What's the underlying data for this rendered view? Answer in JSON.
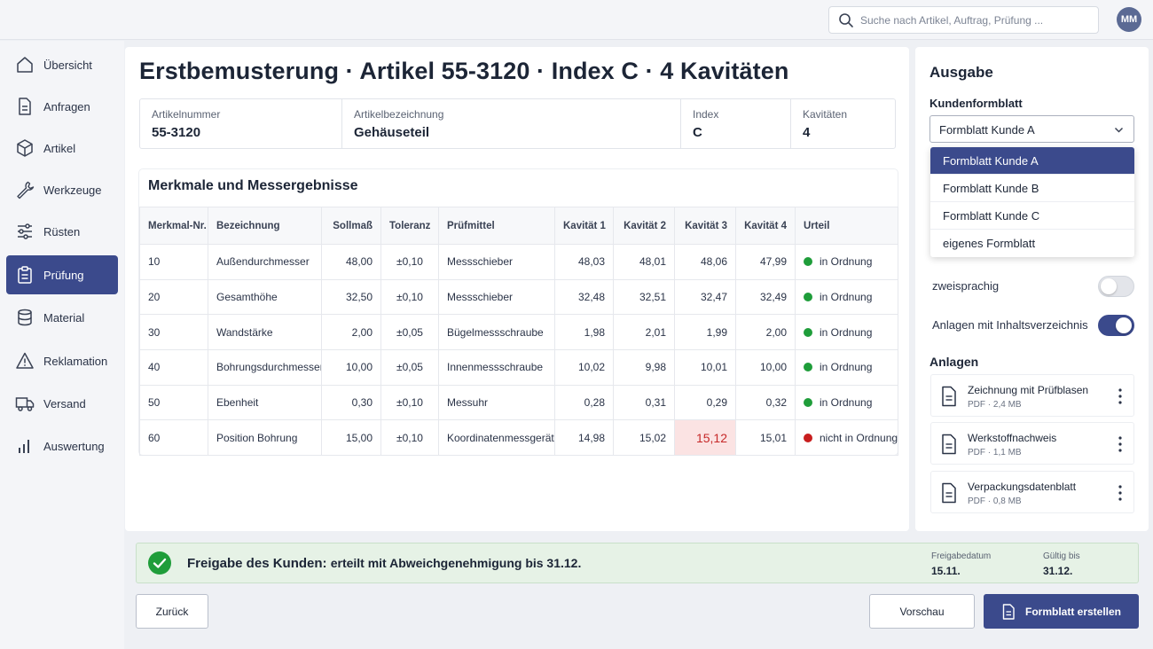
{
  "search": {
    "placeholder": "Suche nach Artikel, Auftrag, Prüfung ..."
  },
  "user": {
    "initials": "MM"
  },
  "sidebar": {
    "items": [
      {
        "label": "Übersicht",
        "icon": "home-icon"
      },
      {
        "label": "Anfragen",
        "icon": "document-icon"
      },
      {
        "label": "Artikel",
        "icon": "box-icon"
      },
      {
        "label": "Werkzeuge",
        "icon": "wrench-icon"
      },
      {
        "label": "Rüsten",
        "icon": "sliders-icon"
      },
      {
        "label": "Prüfung",
        "icon": "clipboard-icon",
        "active": true
      },
      {
        "label": "Material",
        "icon": "database-icon"
      },
      {
        "label": "Reklamation",
        "icon": "warning-icon"
      },
      {
        "label": "Versand",
        "icon": "truck-icon"
      },
      {
        "label": "Auswertung",
        "icon": "bar-chart-icon"
      }
    ]
  },
  "main": {
    "title": "Erstbemusterung · Artikel 55-3120 · Index C · 4 Kavitäten",
    "info": [
      {
        "label": "Artikelnummer",
        "value": "55-3120"
      },
      {
        "label": "Artikelbezeichnung",
        "value": "Gehäuseteil"
      },
      {
        "label": "Index",
        "value": "C"
      },
      {
        "label": "Kavitäten",
        "value": "4"
      }
    ],
    "table": {
      "title": "Merkmale und Messergebnisse",
      "headers": [
        "Merkmal-Nr.",
        "Bezeichnung",
        "Sollmaß",
        "Toleranz",
        "Prüfmittel",
        "Kavität 1",
        "Kavität 2",
        "Kavität 3",
        "Kavität 4",
        "Urteil"
      ],
      "rows": [
        {
          "nr": "10",
          "name": "Außendurchmesser",
          "soll": "48,00",
          "tol": "±0,10",
          "mittel": "Messschieber",
          "k1": "48,03",
          "k2": "48,01",
          "k3": "48,06",
          "k4": "47,99",
          "urteil": "in Ordnung",
          "ok": true
        },
        {
          "nr": "20",
          "name": "Gesamthöhe",
          "soll": "32,50",
          "tol": "±0,10",
          "mittel": "Messschieber",
          "k1": "32,48",
          "k2": "32,51",
          "k3": "32,47",
          "k4": "32,49",
          "urteil": "in Ordnung",
          "ok": true
        },
        {
          "nr": "30",
          "name": "Wandstärke",
          "soll": "2,00",
          "tol": "±0,05",
          "mittel": "Bügelmessschraube",
          "k1": "1,98",
          "k2": "2,01",
          "k3": "1,99",
          "k4": "2,00",
          "urteil": "in Ordnung",
          "ok": true
        },
        {
          "nr": "40",
          "name": "Bohrungsdurchmesser",
          "soll": "10,00",
          "tol": "±0,05",
          "mittel": "Innenmessschraube",
          "k1": "10,02",
          "k2": "9,98",
          "k3": "10,01",
          "k4": "10,00",
          "urteil": "in Ordnung",
          "ok": true
        },
        {
          "nr": "50",
          "name": "Ebenheit",
          "soll": "0,30",
          "tol": "±0,10",
          "mittel": "Messuhr",
          "k1": "0,28",
          "k2": "0,31",
          "k3": "0,29",
          "k4": "0,32",
          "urteil": "in Ordnung",
          "ok": true
        },
        {
          "nr": "60",
          "name": "Position Bohrung",
          "soll": "15,00",
          "tol": "±0,10",
          "mittel": "Koordinatenmessgerät",
          "k1": "14,98",
          "k2": "15,02",
          "k3": "15,12",
          "k4": "15,01",
          "urteil": "nicht in Ordnung",
          "ok": false
        }
      ]
    }
  },
  "output": {
    "title": "Ausgabe",
    "form_label": "Kundenformblatt",
    "selected": "Formblatt Kunde A",
    "options": [
      "Formblatt Kunde A",
      "Formblatt Kunde B",
      "Formblatt Kunde C",
      "eigenes Formblatt"
    ],
    "toggles": [
      {
        "label": "zweisprachig",
        "on": false
      },
      {
        "label": "Anlagen mit Inhaltsverzeichnis",
        "on": true
      }
    ],
    "attachments_title": "Anlagen",
    "attachments": [
      {
        "name": "Zeichnung mit Prüfblasen",
        "meta": "PDF · 2,4 MB"
      },
      {
        "name": "Werkstoffnachweis",
        "meta": "PDF · 1,1 MB"
      },
      {
        "name": "Verpackungsdatenblatt",
        "meta": "PDF · 0,8 MB"
      }
    ]
  },
  "status": {
    "label": "Freigabe des Kunden:",
    "text": "erteilt mit Abweichgenehmigung bis 31.12.",
    "release_label": "Freigabedatum",
    "release_value": "15.11.",
    "valid_label": "Gültig bis",
    "valid_value": "31.12."
  },
  "buttons": {
    "back": "Zurück",
    "preview": "Vorschau",
    "create": "Formblatt erstellen"
  },
  "colors": {
    "accent": "#3b4a8c",
    "ok": "#1f9d3a",
    "nok": "#c81e1e",
    "success_bg": "#e6f2e6"
  }
}
